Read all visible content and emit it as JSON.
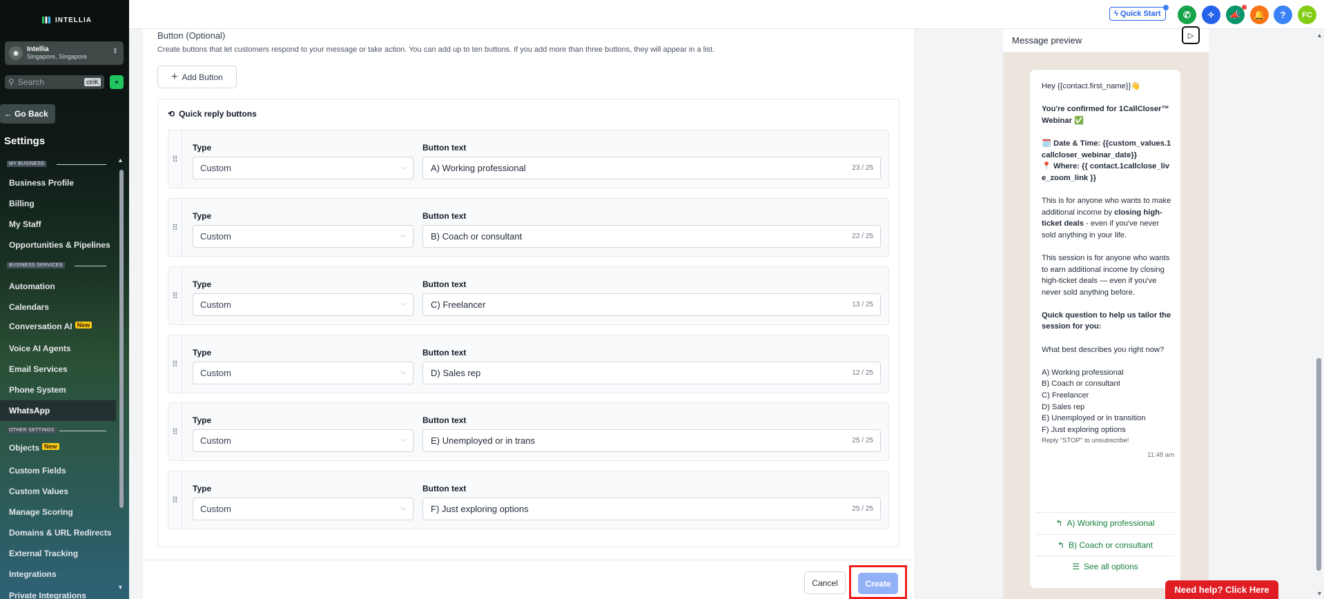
{
  "brand": {
    "name": "INTELLIA"
  },
  "account": {
    "name": "Intellia",
    "location": "Singapore, Singapore"
  },
  "search": {
    "placeholder": "Search",
    "shortcut": "ctrlK"
  },
  "sidebar": {
    "go_back": "Go Back",
    "title": "Settings",
    "sections": {
      "my_business": "MY BUSINESS",
      "business_services": "BUSINESS SERVICES",
      "other_settings": "OTHER SETTINGS"
    },
    "items": [
      {
        "label": "Business Profile"
      },
      {
        "label": "Billing"
      },
      {
        "label": "My Staff"
      },
      {
        "label": "Opportunities & Pipelines"
      },
      {
        "label": "Automation"
      },
      {
        "label": "Calendars"
      },
      {
        "label": "Conversation AI",
        "badge": "New"
      },
      {
        "label": "Voice AI Agents"
      },
      {
        "label": "Email Services"
      },
      {
        "label": "Phone System"
      },
      {
        "label": "WhatsApp"
      },
      {
        "label": "Objects",
        "badge": "New"
      },
      {
        "label": "Custom Fields"
      },
      {
        "label": "Custom Values"
      },
      {
        "label": "Manage Scoring"
      },
      {
        "label": "Domains & URL Redirects"
      },
      {
        "label": "External Tracking"
      },
      {
        "label": "Integrations"
      },
      {
        "label": "Private Integrations"
      }
    ]
  },
  "topbar": {
    "quick_start": "Quick Start",
    "user_initials": "FC"
  },
  "main": {
    "section_title": "Button (Optional)",
    "section_desc": "Create buttons that let customers respond to your message or take action. You can add up to ten buttons. If you add more than three buttons, they will appear in a list.",
    "add_button": "Add Button",
    "quick_reply_title": "Quick reply buttons",
    "type_label": "Type",
    "text_label": "Button text",
    "rows": [
      {
        "type": "Custom",
        "text": "A) Working professional",
        "count": "23 / 25"
      },
      {
        "type": "Custom",
        "text": "B) Coach or consultant",
        "count": "22 / 25"
      },
      {
        "type": "Custom",
        "text": "C) Freelancer",
        "count": "13 / 25"
      },
      {
        "type": "Custom",
        "text": "D) Sales rep",
        "count": "12 / 25"
      },
      {
        "type": "Custom",
        "text": "E) Unemployed or in trans",
        "count": "25 / 25"
      },
      {
        "type": "Custom",
        "text": "F) Just exploring options",
        "count": "25 / 25"
      }
    ],
    "cancel": "Cancel",
    "create": "Create"
  },
  "preview": {
    "title": "Message preview",
    "greeting": "Hey {{contact.first_name}}👋",
    "confirm": "You're confirmed for 1CallCloser™ Webinar ✅",
    "datetime": "🗓️ Date & Time: {{custom_values.1callcloser_webinar_date}}",
    "where": "📍 Where: {{ contact.1callclose_live_zoom_link }}",
    "p1_a": "This is for anyone who wants to make additional income by ",
    "p1_b": "closing high-ticket deals",
    "p1_c": " - even if you've never sold anything in your life.",
    "p2": "This session is for anyone who wants to earn additional income by closing high-ticket deals — even if you've never sold anything before.",
    "question": "Quick question to help us tailor the session for you:",
    "ask": "What best describes you right now?",
    "options": "A) Working professional\nB) Coach or consultant\nC) Freelancer\nD) Sales rep\nE) Unemployed or in transition\nF) Just exploring options",
    "unsubscribe": "Reply \"STOP\" to unsubscribe!",
    "time": "11:48 am",
    "buttons": [
      "A) Working professional",
      "B) Coach or consultant",
      "See all options"
    ]
  },
  "help": "Need help? Click Here",
  "colors": {
    "accent": "#2563eb",
    "whatsapp_green": "#15803d",
    "highlight": "#ef1c1c"
  }
}
